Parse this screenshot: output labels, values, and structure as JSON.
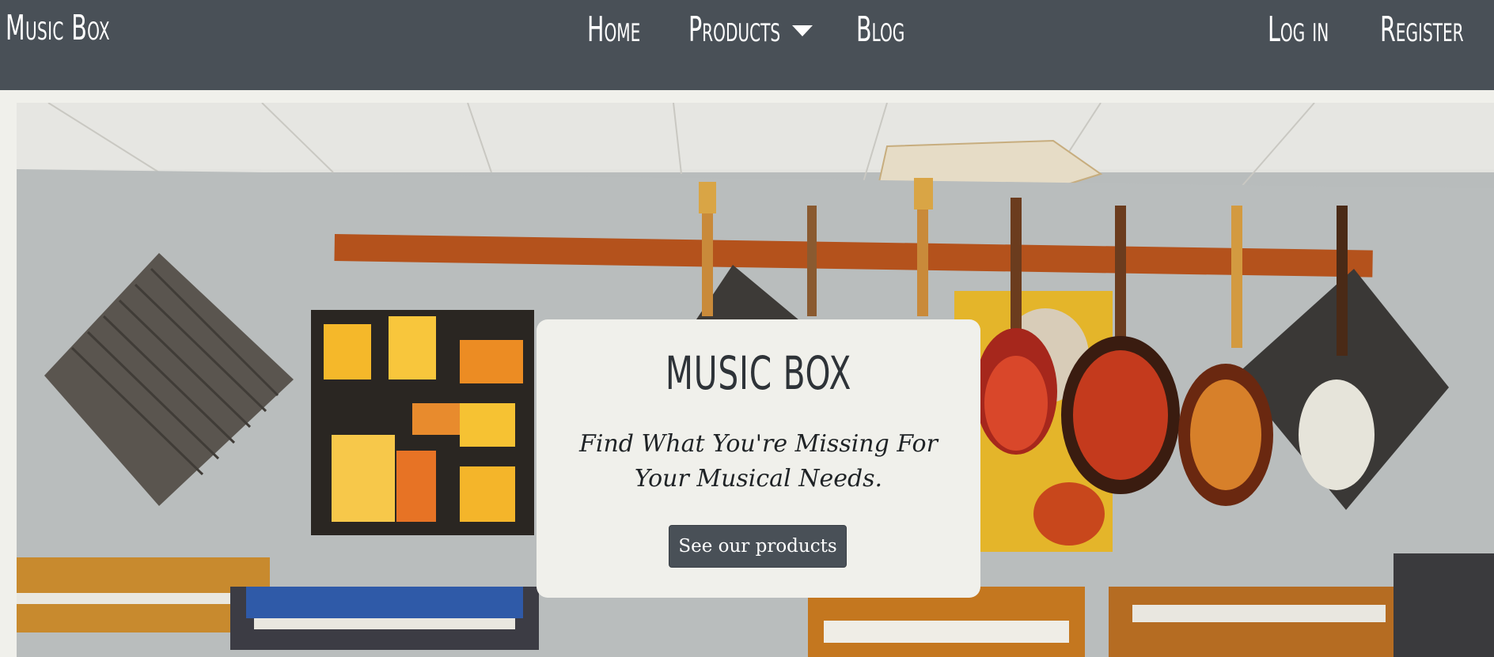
{
  "navbar": {
    "brand": "Music Box",
    "links": {
      "home": "Home",
      "products": "Products",
      "blog": "Blog"
    },
    "auth": {
      "login": "Log in",
      "register": "Register"
    },
    "background_color": "#495057",
    "text_color": "#ffffff"
  },
  "hero": {
    "title": "MUSIC BOX",
    "tagline": "Find What You're Missing For Your Musical Needs.",
    "button_label": "See our products",
    "card_color": "#f0f0eb",
    "button_color": "#495057",
    "image_subject": "music studio wall with hanging guitars, acoustic foam panels, abstract painting and synthesizer keyboards"
  }
}
